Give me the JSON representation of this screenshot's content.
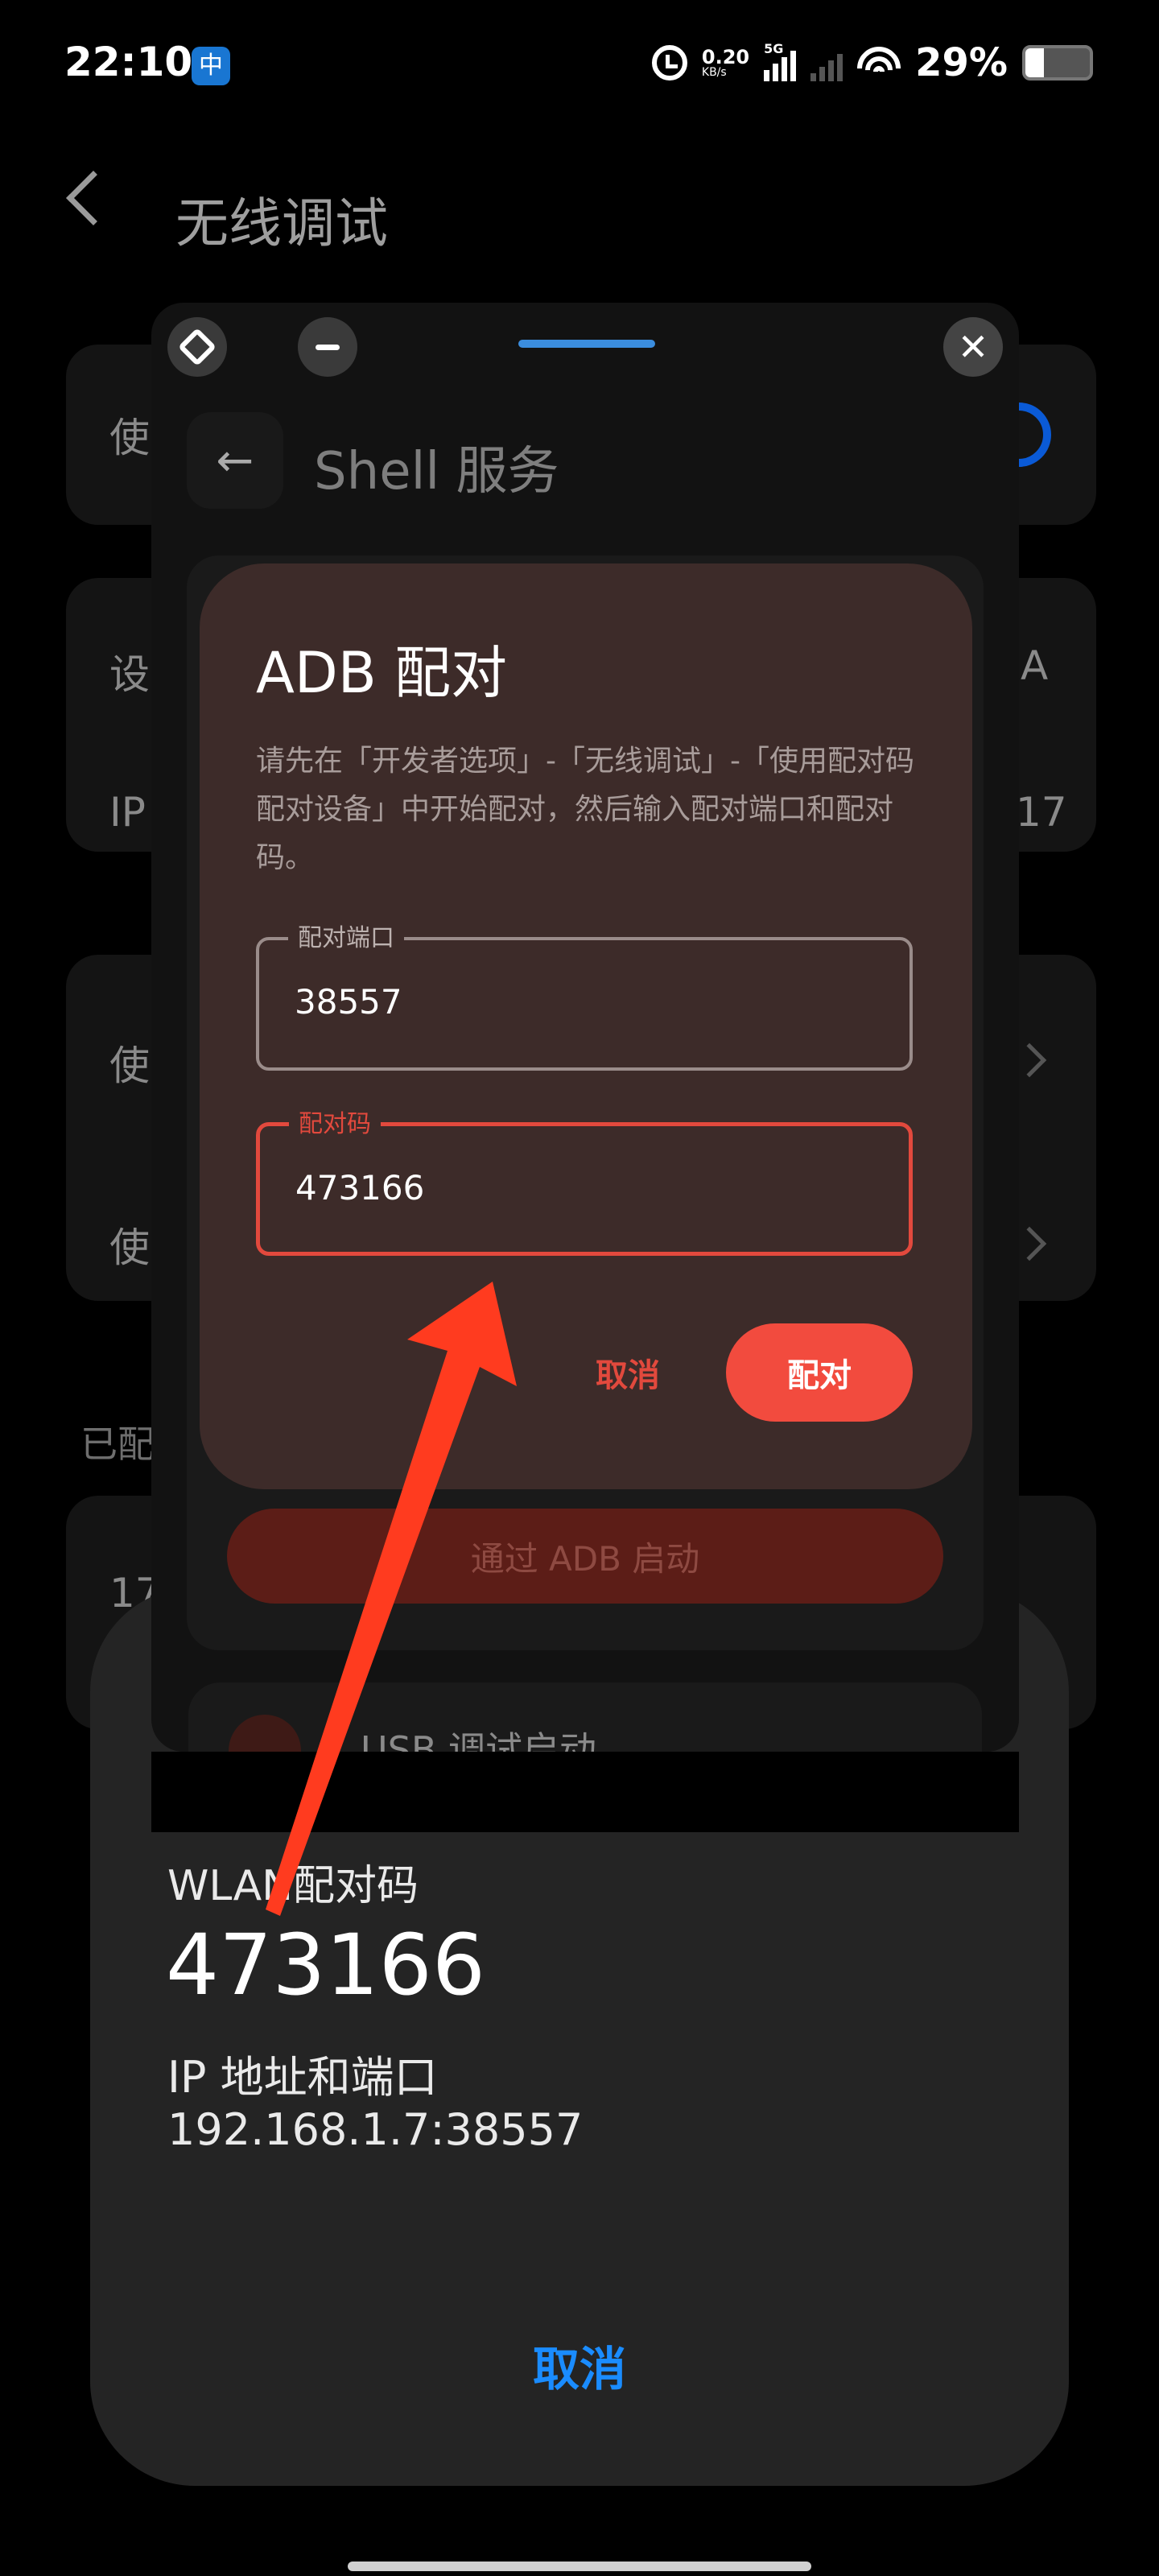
{
  "status_bar": {
    "time": "22:10",
    "app_icon_glyph": "中",
    "net_speed_value": "0.20",
    "net_speed_unit": "KB/s",
    "sim1_label": "5G",
    "battery": "29%",
    "battery_level": 0.29
  },
  "settings_page": {
    "title": "无线调试",
    "row1_label": "使",
    "row2_label": "设",
    "row2_value": "A",
    "row3_label": "IP",
    "row3_value": "17",
    "row4_label": "使",
    "row5_label": "使",
    "section_label": "已配",
    "row6_label": "17"
  },
  "pairing_sheet": {
    "wlan_label": "WLAN配对码",
    "wlan_code": "473166",
    "ip_label": "IP 地址和端口",
    "ip_value": "192.168.1.7:38557",
    "cancel_label": "取消"
  },
  "floating_window": {
    "shell_back_glyph": "←",
    "shell_title": "Shell 服务",
    "adb_start_label": "通过 ADB 启动",
    "usb_label": "USB 调试启动",
    "close_glyph": "✕"
  },
  "dialog": {
    "title": "ADB 配对",
    "description": "请先在「开发者选项」-「无线调试」-「使用配对码配对设备」中开始配对，然后输入配对端口和配对码。",
    "port_label": "配对端口",
    "port_value": "38557",
    "code_label": "配对码",
    "code_value": "473166",
    "cancel_label": "取消",
    "pair_label": "配对"
  },
  "colors": {
    "accent_blue": "#1a8cff",
    "accent_red": "#f24b3e",
    "dialog_bg": "#3d2b29",
    "annotation_arrow": "#ff3b1f"
  }
}
